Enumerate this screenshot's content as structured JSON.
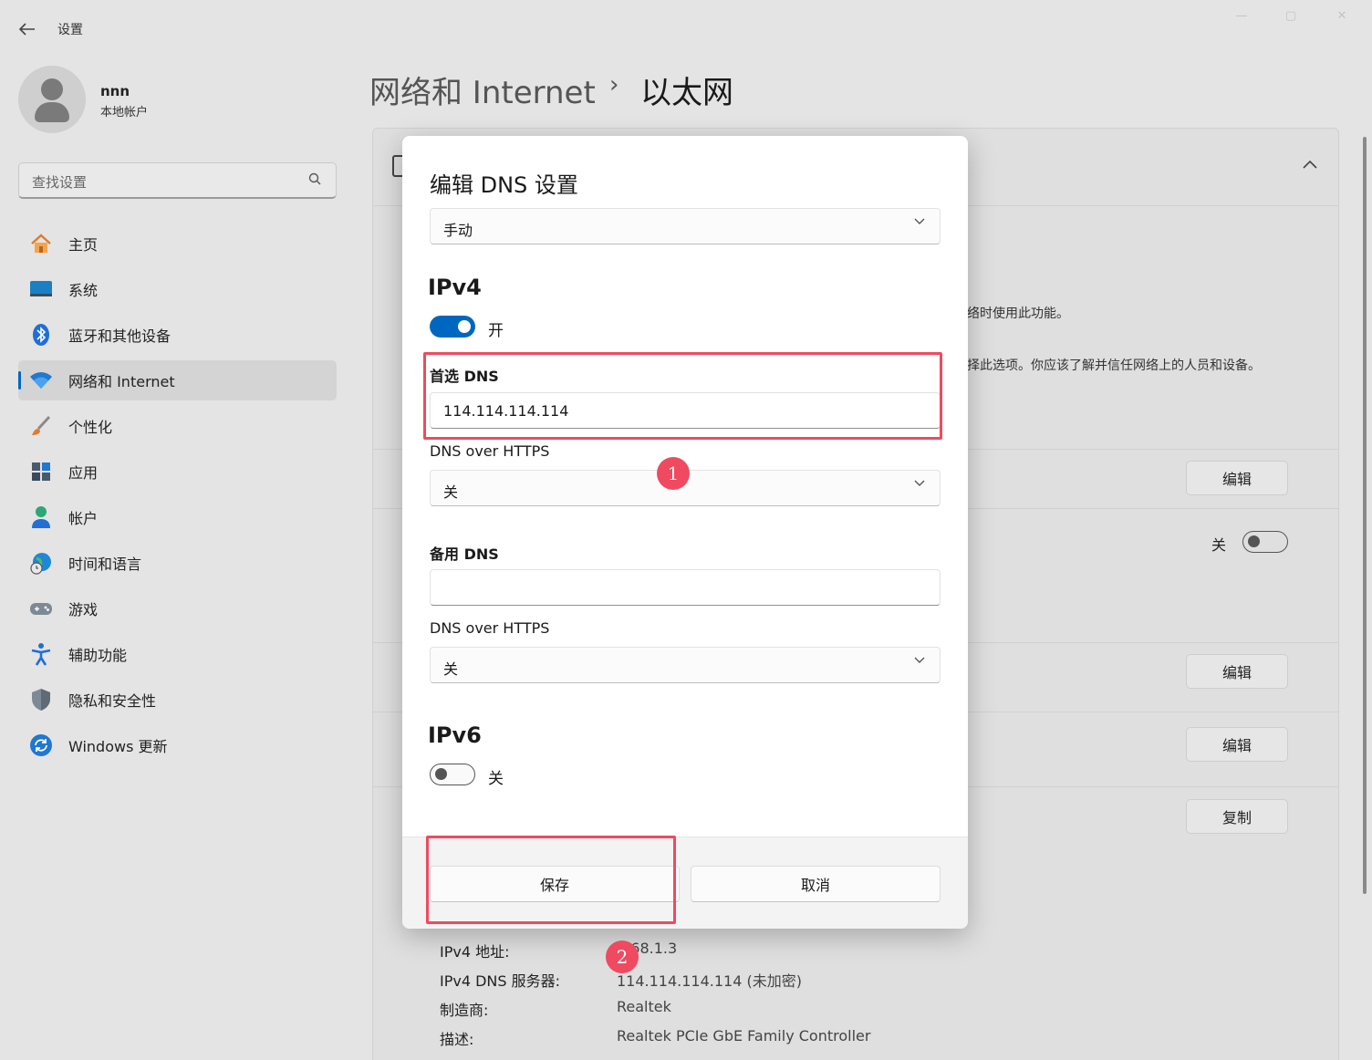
{
  "app": {
    "back_icon": "arrow-left-icon",
    "title": "设置"
  },
  "user": {
    "name": "nnn",
    "type": "本地帐户"
  },
  "search": {
    "placeholder": "查找设置"
  },
  "nav": [
    {
      "label": "主页",
      "icon": "home-icon"
    },
    {
      "label": "系统",
      "icon": "display-icon"
    },
    {
      "label": "蓝牙和其他设备",
      "icon": "bluetooth-icon"
    },
    {
      "label": "网络和 Internet",
      "icon": "wifi-icon",
      "active": true
    },
    {
      "label": "个性化",
      "icon": "brush-icon"
    },
    {
      "label": "应用",
      "icon": "apps-icon"
    },
    {
      "label": "帐户",
      "icon": "person-icon"
    },
    {
      "label": "时间和语言",
      "icon": "globe-clock-icon"
    },
    {
      "label": "游戏",
      "icon": "gamepad-icon"
    },
    {
      "label": "辅助功能",
      "icon": "accessibility-icon"
    },
    {
      "label": "隐私和安全性",
      "icon": "shield-icon"
    },
    {
      "label": "Windows 更新",
      "icon": "update-icon"
    }
  ],
  "breadcrumb": {
    "parent": "网络和 Internet",
    "separator": "›",
    "current": "以太网"
  },
  "background": {
    "text1": "络时使用此功能。",
    "text2": "择此选项。你应该了解并信任网络上的人员和设备。",
    "edit_label": "编辑",
    "copy_label": "复制",
    "toggle_label": "关",
    "properties": [
      {
        "label": "IPv4 地址:",
        "value": ".168.1.3"
      },
      {
        "label": "IPv4 DNS 服务器:",
        "value": "114.114.114.114 (未加密)"
      },
      {
        "label": "制造商:",
        "value": "Realtek"
      },
      {
        "label": "描述:",
        "value": "Realtek PCIe GbE Family Controller"
      }
    ]
  },
  "dialog": {
    "title": "编辑 DNS 设置",
    "mode": "手动",
    "ipv4": {
      "heading": "IPv4",
      "toggle_on": true,
      "toggle_label": "开",
      "preferred_label": "首选 DNS",
      "preferred_value": "114.114.114.114",
      "doh_label": "DNS over HTTPS",
      "doh_value": "关",
      "alternate_label": "备用 DNS",
      "alternate_value": "",
      "doh2_label": "DNS over HTTPS",
      "doh2_value": "关"
    },
    "ipv6": {
      "heading": "IPv6",
      "toggle_on": false,
      "toggle_label": "关"
    },
    "save_label": "保存",
    "cancel_label": "取消"
  },
  "annotations": {
    "badge1": "1",
    "badge2": "2",
    "color": "#ef4a5f"
  },
  "colors": {
    "accent": "#0067c0"
  }
}
